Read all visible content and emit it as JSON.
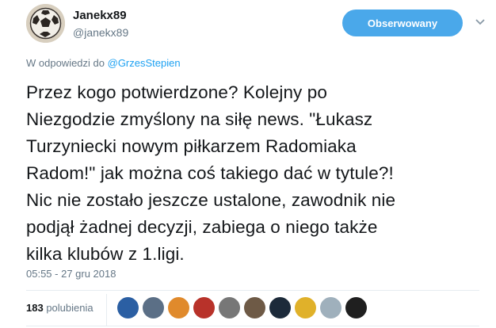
{
  "author": {
    "name": "Janekx89",
    "handle": "@janekx89",
    "avatar_icon": "soccer-ball-icon"
  },
  "follow_button": {
    "label": "Obserwowany"
  },
  "reply_context": {
    "prefix": "W odpowiedzi do",
    "mention": "@GrzesStepien"
  },
  "tweet": {
    "text": "Przez kogo potwierdzone? Kolejny po\nNiezgodzie zmyślony na siłę news. \"Łukasz\nTurzyniecki nowym piłkarzem Radomiaka\nRadom!\" jak można coś takiego dać w tytule?!\nNic nie zostało jeszcze ustalone, zawodnik nie\npodjął żadnej decyzji, zabiega o niego także\nkilka klubów z 1.ligi.",
    "timestamp": "05:55 - 27 gru 2018"
  },
  "stats": {
    "likes_count": "183",
    "likes_label": "polubienia"
  },
  "likers": [
    {
      "color": "#2b5fa3"
    },
    {
      "color": "#5b6f86"
    },
    {
      "color": "#e08a2c"
    },
    {
      "color": "#b8322a"
    },
    {
      "color": "#777777"
    },
    {
      "color": "#6e5a46"
    },
    {
      "color": "#1c2a3a"
    },
    {
      "color": "#e0b12a"
    },
    {
      "color": "#9fb0bc"
    },
    {
      "color": "#1f1f1f"
    }
  ],
  "colors": {
    "accent": "#4aa8ea",
    "link": "#1da1f2",
    "secondary_text": "#657786"
  }
}
